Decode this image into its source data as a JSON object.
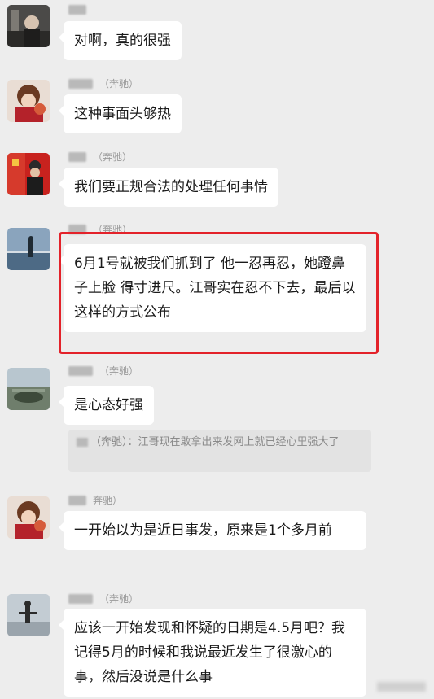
{
  "messages": [
    {
      "sender": "",
      "text": "对啊，真的很强"
    },
    {
      "sender": "（奔驰）",
      "text": "这种事面头够热"
    },
    {
      "sender": "（奔驰）",
      "text": "我们要正规合法的处理任何事情"
    },
    {
      "sender": "（奔驰）",
      "text": "6月1号就被我们抓到了 他一忍再忍，她蹬鼻子上脸 得寸进尺。江哥实在忍不下去，最后以这样的方式公布"
    },
    {
      "sender": "（奔驰）",
      "text": "是心态好强"
    },
    {
      "sender": "奔驰）",
      "text": "一开始以为是近日事发，原来是1个多月前"
    },
    {
      "sender": "（奔驰）",
      "text": "应该一开始发现和怀疑的日期是4.5月吧？我记得5月的时候和我说最近发生了很激心的事，然后没说是什么事"
    }
  ],
  "quote": {
    "text": "（奔驰）：江哥现在敢拿出来发网上就已经心里强大了"
  },
  "colors": {
    "background": "#ededed",
    "bubble": "#ffffff",
    "highlight": "#e3222a"
  }
}
